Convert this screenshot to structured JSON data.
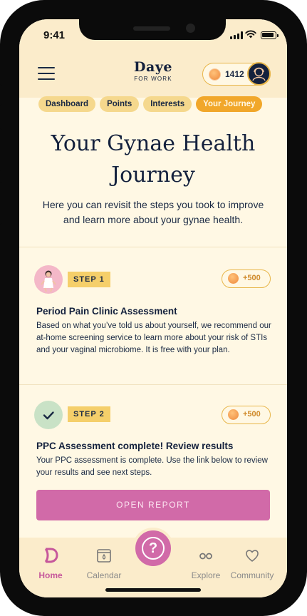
{
  "status": {
    "time": "9:41"
  },
  "header": {
    "brand_name": "Daye",
    "brand_sub": "FOR WORK",
    "points": "1412"
  },
  "tabs": [
    {
      "label": "Dashboard",
      "active": false
    },
    {
      "label": "Points",
      "active": false
    },
    {
      "label": "Interests",
      "active": false
    },
    {
      "label": "Your Journey",
      "active": true
    }
  ],
  "page": {
    "title": "Your Gynae Health Journey",
    "intro": "Here you can revisit the steps you took to improve and learn more about your gynae health."
  },
  "steps": [
    {
      "label": "STEP 1",
      "reward": "+500",
      "title": "Period Pain Clinic Assessment",
      "description": "Based on what you’ve told us about yourself, we recommend our at-home screening service to learn more about your risk of STIs and your vaginal microbiome. It is free with your plan."
    },
    {
      "label": "STEP 2",
      "reward": "+500",
      "title": "PPC Assessment complete! Review results",
      "description": "Your PPC assessment is complete. Use the link below to review your results and see next steps.",
      "button": "OPEN REPORT"
    }
  ],
  "nav": [
    {
      "label": "Home",
      "icon": "daye-logo-icon",
      "active": true
    },
    {
      "label": "Calendar",
      "icon": "calendar-icon",
      "active": false
    },
    {
      "label": "Explore",
      "icon": "explore-icon",
      "active": false
    },
    {
      "label": "Community",
      "icon": "heart-icon",
      "active": false
    }
  ],
  "colors": {
    "background": "#fff8e4",
    "header": "#fbeccb",
    "accent_pink": "#d16aa8",
    "accent_orange": "#f1a72a",
    "navy": "#14213d",
    "step_label": "#f5cf6a"
  }
}
